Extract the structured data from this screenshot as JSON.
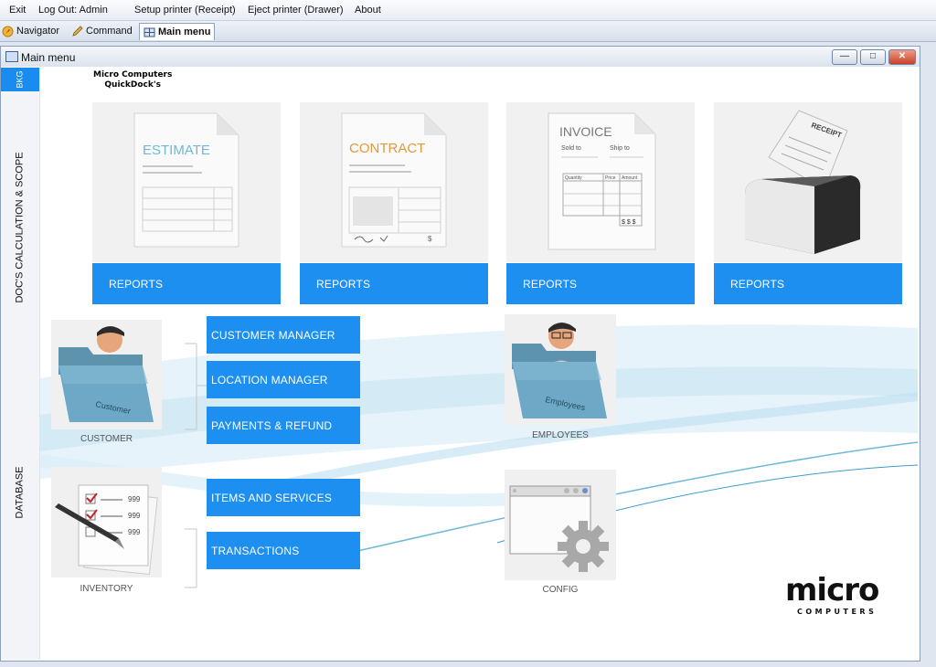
{
  "menubar": {
    "exit": "Exit",
    "logout": "Log Out: Admin",
    "setup_printer": "Setup printer (Receipt)",
    "eject_printer": "Eject printer (Drawer)",
    "about": "About"
  },
  "tabs": {
    "navigator": "Navigator",
    "command": "Command",
    "main_menu": "Main menu"
  },
  "window": {
    "title": "Main menu",
    "minimize": "—",
    "maximize": "□",
    "close": "✕"
  },
  "sidebar": {
    "bkg": "BKG",
    "docs": "DOC'S CALCULATION & SCOPE",
    "database": "DATABASE"
  },
  "brand": {
    "line1": "Micro Computers",
    "line2": "QuickDock's"
  },
  "docs": {
    "estimate": {
      "word": "ESTIMATE",
      "button": "REPORTS"
    },
    "contract": {
      "word": "CONTRACT",
      "button": "REPORTS"
    },
    "invoice": {
      "word": "INVOICE",
      "sold_to": "Sold to",
      "ship_to": "Ship to",
      "quantity": "Quantity",
      "price": "Price",
      "amount": "Amount",
      "dollars": "$ $ $",
      "button": "REPORTS"
    },
    "receipt": {
      "word": "RECEIPT",
      "button": "REPORTS"
    }
  },
  "database": {
    "customer": {
      "caption": "CUSTOMER",
      "folder_label": "Customer"
    },
    "employees": {
      "caption": "EMPLOYEES",
      "folder_label": "Employees"
    },
    "inventory": {
      "caption": "INVENTORY",
      "num1": "999",
      "num2": "999",
      "num3": "999"
    },
    "config": {
      "caption": "CONFIG"
    },
    "buttons": {
      "customer_manager": "CUSTOMER MANAGER",
      "location_manager": "LOCATION MANAGER",
      "payments_refund": "PAYMENTS & REFUND",
      "items_services": "ITEMS AND SERVICES",
      "transactions": "TRANSACTIONS"
    }
  },
  "logo": {
    "word": "micro",
    "sub": "COMPUTERS"
  },
  "colors": {
    "accent": "#1d8ff0",
    "swoosh": "#bfe3f3"
  }
}
